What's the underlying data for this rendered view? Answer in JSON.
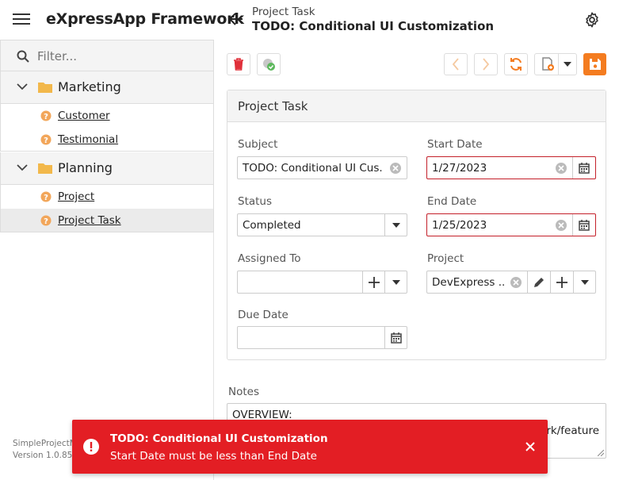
{
  "header": {
    "app_title": "eXpressApp Framework",
    "breadcrumb": "Project Task",
    "title": "TODO: Conditional UI Customization"
  },
  "sidebar": {
    "filter_placeholder": "Filter...",
    "groups": [
      {
        "label": "Marketing",
        "items": [
          {
            "label": "Customer"
          },
          {
            "label": "Testimonial"
          }
        ]
      },
      {
        "label": "Planning",
        "items": [
          {
            "label": "Project"
          },
          {
            "label": "Project Task",
            "selected": true
          }
        ]
      }
    ],
    "footer_line1": "SimpleProjectM",
    "footer_line2": "Version 1.0.859"
  },
  "panel": {
    "title": "Project Task",
    "fields": {
      "subject": {
        "label": "Subject",
        "value": "TODO: Conditional UI Cus..."
      },
      "start_date": {
        "label": "Start Date",
        "value": "1/27/2023"
      },
      "status": {
        "label": "Status",
        "value": "Completed"
      },
      "end_date": {
        "label": "End Date",
        "value": "1/25/2023"
      },
      "assigned_to": {
        "label": "Assigned To",
        "value": ""
      },
      "project": {
        "label": "Project",
        "value": "DevExpress ..."
      },
      "due_date": {
        "label": "Due Date",
        "value": ""
      }
    }
  },
  "notes": {
    "label": "Notes",
    "line1": "OVERVIEW:",
    "line2": "rk/feature"
  },
  "toast": {
    "title": "TODO: Conditional UI Customization",
    "message": "Start Date must be less than End Date"
  },
  "colors": {
    "accent": "#f47c20",
    "error": "#e31e24",
    "invalid_border": "#c4202a",
    "delete_icon": "#e0303a",
    "folder": "#f2b84b"
  }
}
